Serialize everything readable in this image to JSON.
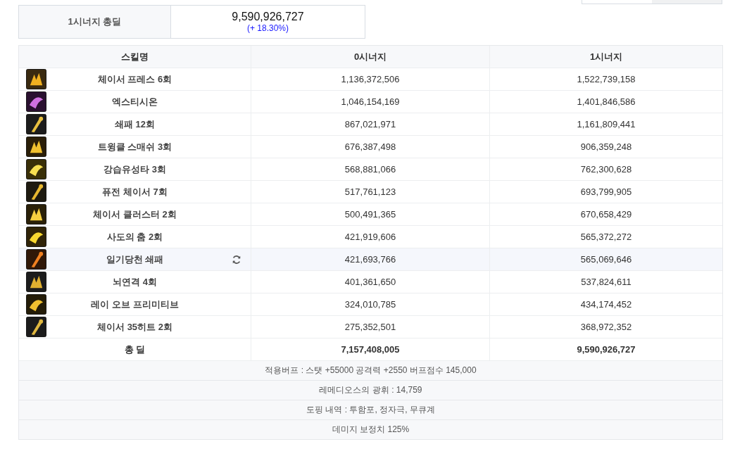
{
  "summary": {
    "label": "1시너지 총딜",
    "value": "9,590,926,727",
    "change": "(+ 18.30%)"
  },
  "table": {
    "columns": [
      "스킬명",
      "0시너지",
      "1시너지"
    ],
    "rows": [
      {
        "skill": "체이서 프레스 6회",
        "synergy_0": "1,136,372,506",
        "synergy_1": "1,522,739,158",
        "highlighted": false,
        "swap": false
      },
      {
        "skill": "엑스티시온",
        "synergy_0": "1,046,154,169",
        "synergy_1": "1,401,846,586",
        "highlighted": false,
        "swap": false
      },
      {
        "skill": "쇄패 12회",
        "synergy_0": "867,021,971",
        "synergy_1": "1,161,809,441",
        "highlighted": false,
        "swap": false
      },
      {
        "skill": "트윙클 스매쉬 3회",
        "synergy_0": "676,387,498",
        "synergy_1": "906,359,248",
        "highlighted": false,
        "swap": false
      },
      {
        "skill": "강습유성타 3회",
        "synergy_0": "568,881,066",
        "synergy_1": "762,300,628",
        "highlighted": false,
        "swap": false
      },
      {
        "skill": "퓨전 체이서 7회",
        "synergy_0": "517,761,123",
        "synergy_1": "693,799,905",
        "highlighted": false,
        "swap": false
      },
      {
        "skill": "체이서 클러스터 2회",
        "synergy_0": "500,491,365",
        "synergy_1": "670,658,429",
        "highlighted": false,
        "swap": false
      },
      {
        "skill": "사도의 춤 2회",
        "synergy_0": "421,919,606",
        "synergy_1": "565,372,272",
        "highlighted": false,
        "swap": false
      },
      {
        "skill": "일기당천 쇄패",
        "synergy_0": "421,693,766",
        "synergy_1": "565,069,646",
        "highlighted": true,
        "swap": true
      },
      {
        "skill": "뇌연격 4회",
        "synergy_0": "401,361,650",
        "synergy_1": "537,824,611",
        "highlighted": false,
        "swap": false
      },
      {
        "skill": "레이 오브 프리미티브",
        "synergy_0": "324,010,785",
        "synergy_1": "434,174,452",
        "highlighted": false,
        "swap": false
      },
      {
        "skill": "체이서 35히트 2회",
        "synergy_0": "275,352,501",
        "synergy_1": "368,972,352",
        "highlighted": false,
        "swap": false
      }
    ],
    "total": {
      "label": "총 딜",
      "synergy_0": "7,157,408,005",
      "synergy_1": "9,590,926,727"
    },
    "notes": [
      "적용버프 : 스탯 +55000 공격력 +2550 버프점수 145,000",
      "레메디오스의 광휘 : 14,759",
      "도핑 내역 : 투함포, 정자극, 무큐계",
      "데미지 보정치 125%"
    ]
  }
}
